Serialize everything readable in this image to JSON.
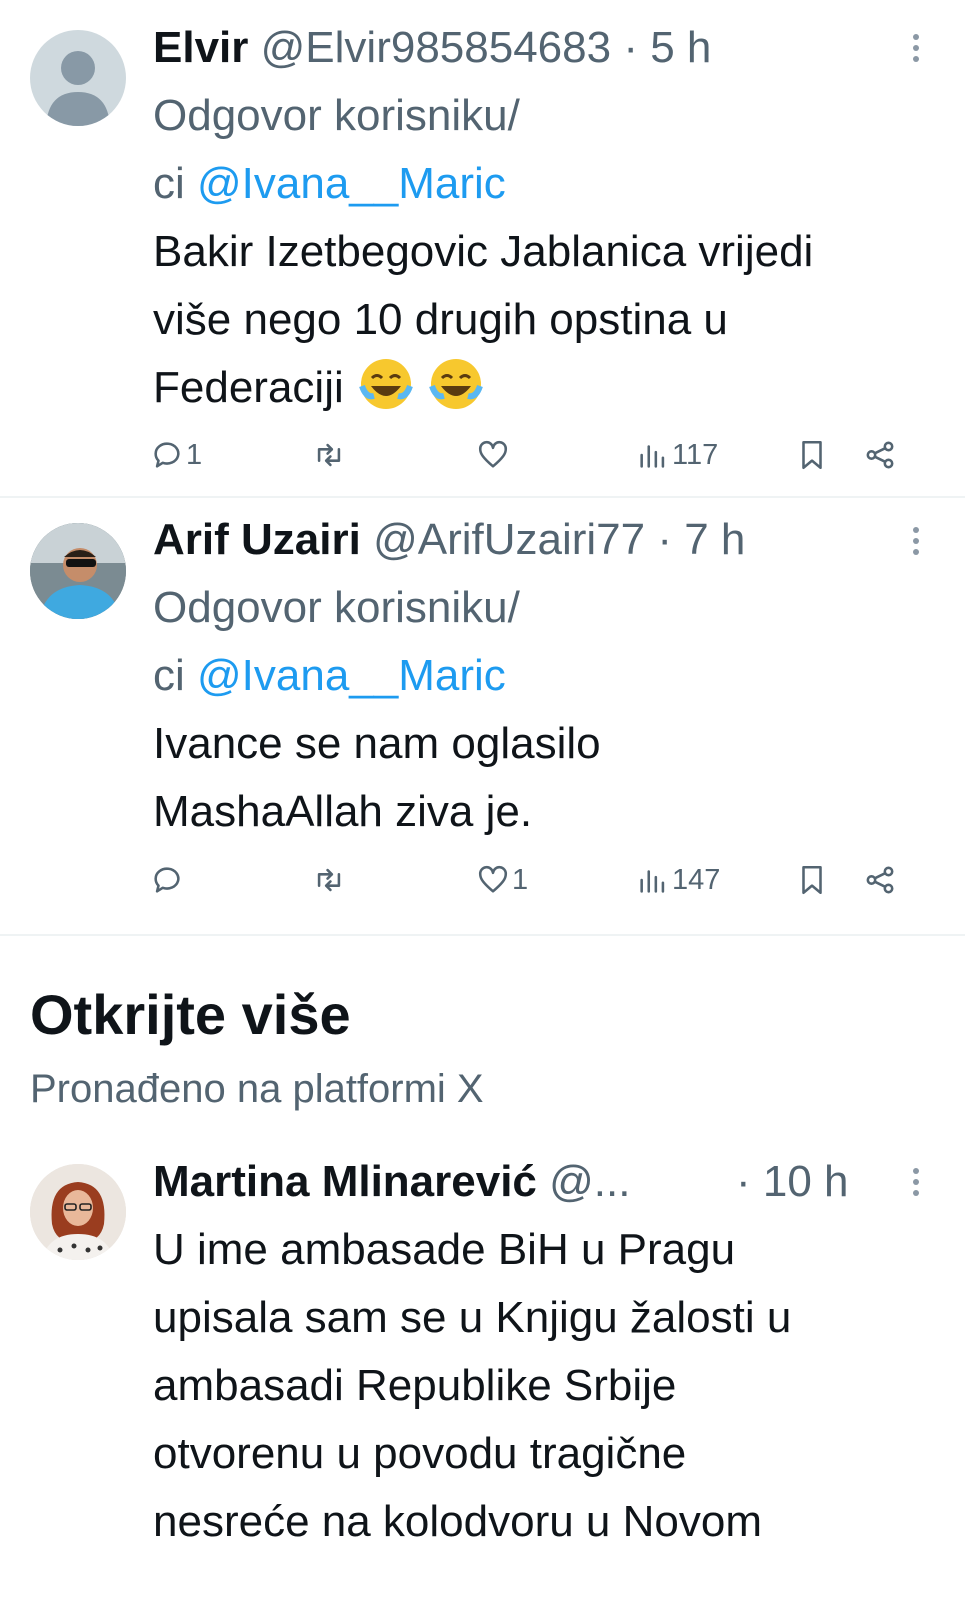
{
  "tweets": [
    {
      "name": "Elvir",
      "handle": "@Elvir985854683",
      "time": "· 5 h",
      "reply_prefix_1": "Odgovor korisniku/",
      "reply_prefix_2": "ci ",
      "reply_to": "@Ivana__Maric",
      "text_lines": [
        "Bakir Izetbegovic Jablanica vrijedi",
        "više nego 10 drugih opstina u",
        "Federaciji"
      ],
      "emoji": "😂😂",
      "replies": "1",
      "reposts": "",
      "likes": "",
      "views": "117"
    },
    {
      "name": "Arif Uzairi",
      "handle": "@ArifUzairi77",
      "time": "· 7 h",
      "reply_prefix_1": "Odgovor korisniku/",
      "reply_prefix_2": "ci ",
      "reply_to": "@Ivana__Maric",
      "text_lines": [
        "Ivance se nam oglasilo",
        "MashaAllah ziva je."
      ],
      "replies": "",
      "reposts": "",
      "likes": "1",
      "views": "147"
    }
  ],
  "discover": {
    "title": "Otkrijte više",
    "subtitle": "Pronađeno na platformi X"
  },
  "discover_tweet": {
    "name": "Martina Mlinarević",
    "handle": "@...",
    "time": "· 10 h",
    "text_lines": [
      "U ime ambasade BiH u Pragu",
      "upisala sam se u Knjigu žalosti u",
      "ambasadi Republike Srbije",
      "otvorenu u povodu tragične",
      "nesreće na kolodvoru u Novom"
    ]
  },
  "icons": {
    "reply": "reply-icon",
    "repost": "repost-icon",
    "like": "heart-icon",
    "views": "views-icon",
    "bookmark": "bookmark-icon",
    "share": "share-icon",
    "more": "more-icon"
  },
  "colors": {
    "link": "#1d9bf0",
    "secondary_text": "#536471",
    "primary_text": "#0f1419"
  }
}
